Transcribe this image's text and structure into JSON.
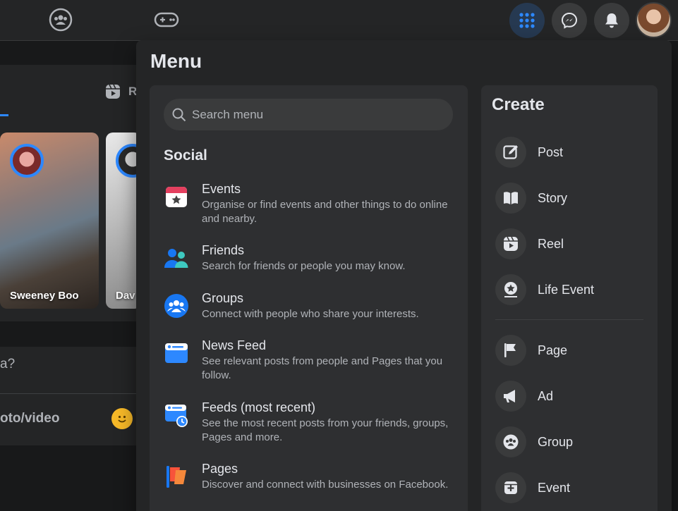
{
  "menu": {
    "title": "Menu",
    "search_placeholder": "Search menu",
    "social_heading": "Social",
    "items": [
      {
        "title": "Events",
        "desc": "Organise or find events and other things to do online and nearby."
      },
      {
        "title": "Friends",
        "desc": "Search for friends or people you may know."
      },
      {
        "title": "Groups",
        "desc": "Connect with people who share your interests."
      },
      {
        "title": "News Feed",
        "desc": "See relevant posts from people and Pages that you follow."
      },
      {
        "title": "Feeds (most recent)",
        "desc": "See the most recent posts from your friends, groups, Pages and more."
      },
      {
        "title": "Pages",
        "desc": "Discover and connect with businesses on Facebook."
      }
    ]
  },
  "create": {
    "title": "Create",
    "items": [
      {
        "label": "Post",
        "icon": "compose-icon"
      },
      {
        "label": "Story",
        "icon": "book-icon"
      },
      {
        "label": "Reel",
        "icon": "reel-icon"
      },
      {
        "label": "Life Event",
        "icon": "star-badge-icon"
      },
      {
        "label": "Page",
        "icon": "flag-icon"
      },
      {
        "label": "Ad",
        "icon": "megaphone-icon"
      },
      {
        "label": "Group",
        "icon": "group-icon"
      },
      {
        "label": "Event",
        "icon": "calendar-plus-icon"
      }
    ]
  },
  "feed": {
    "reels_tab_label": "R",
    "stories": [
      {
        "name": "Sweeney Boo"
      },
      {
        "name": "Dav"
      }
    ],
    "composer_prompt": "a?",
    "photo_video_label": "oto/video"
  },
  "colors": {
    "accent": "#2d88ff",
    "background": "#18191a",
    "surface": "#242526"
  }
}
